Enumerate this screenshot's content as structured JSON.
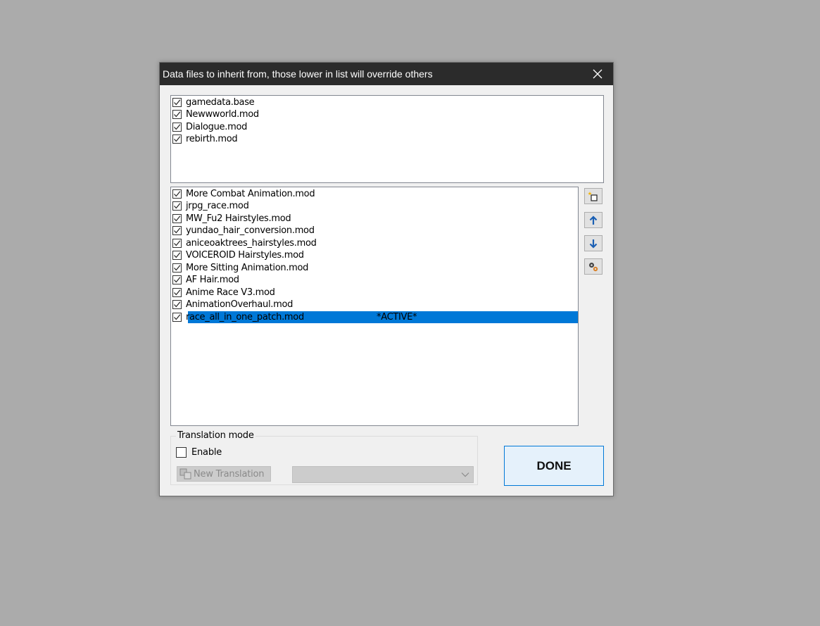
{
  "dialog": {
    "title": "Data files to inherit from, those lower in list will override others"
  },
  "base_files": [
    {
      "label": "gamedata.base",
      "checked": true
    },
    {
      "label": "Newwworld.mod",
      "checked": true
    },
    {
      "label": "Dialogue.mod",
      "checked": true
    },
    {
      "label": "rebirth.mod",
      "checked": true
    }
  ],
  "mod_files": [
    {
      "label": "More Combat Animation.mod",
      "checked": true
    },
    {
      "label": "jrpg_race.mod",
      "checked": true
    },
    {
      "label": "MW_Fu2 Hairstyles.mod",
      "checked": true
    },
    {
      "label": "yundao_hair_conversion.mod",
      "checked": true
    },
    {
      "label": "aniceoaktrees_hairstyles.mod",
      "checked": true
    },
    {
      "label": "VOICEROID Hairstyles.mod",
      "checked": true
    },
    {
      "label": "More Sitting Animation.mod",
      "checked": true
    },
    {
      "label": "AF Hair.mod",
      "checked": true
    },
    {
      "label": "Anime Race V3.mod",
      "checked": true
    },
    {
      "label": "AnimationOverhaul.mod",
      "checked": true
    },
    {
      "label": "race_all_in_one_patch.mod",
      "checked": true,
      "selected": true,
      "tag": "*ACTIVE*"
    }
  ],
  "side_buttons": [
    {
      "name": "new-file-icon"
    },
    {
      "name": "arrow-up-icon"
    },
    {
      "name": "arrow-down-icon"
    },
    {
      "name": "settings-icon"
    }
  ],
  "translation": {
    "group_label": "Translation mode",
    "enable_label": "Enable",
    "enable_checked": false,
    "new_translation_label": "New Translation",
    "combo_value": ""
  },
  "done_label": "DONE",
  "colors": {
    "selection": "#0078d7",
    "titlebar": "#2b2b2b",
    "background": "#ababab"
  }
}
